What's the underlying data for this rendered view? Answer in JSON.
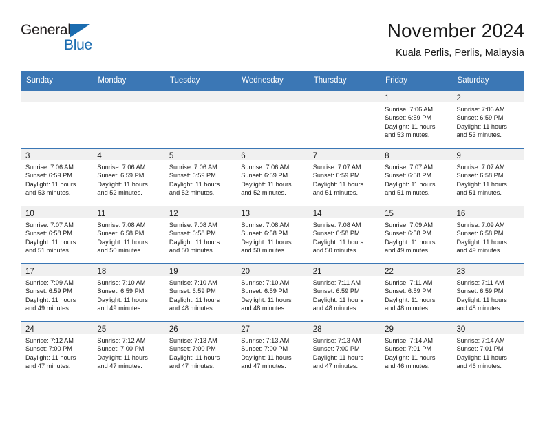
{
  "logo": {
    "word_top": "General",
    "word_bottom": "Blue",
    "triangle_color": "#1b6cb0",
    "top_color": "#231f20",
    "bottom_color": "#1b6cb0"
  },
  "header": {
    "title": "November 2024",
    "subtitle": "Kuala Perlis, Perlis, Malaysia"
  },
  "theme": {
    "header_blue": "#3b77b5",
    "daynum_band": "#f0f0f0",
    "text": "#1a1a1a"
  },
  "weekdays": [
    "Sunday",
    "Monday",
    "Tuesday",
    "Wednesday",
    "Thursday",
    "Friday",
    "Saturday"
  ],
  "weeks": [
    [
      {
        "day": "",
        "empty": true
      },
      {
        "day": "",
        "empty": true
      },
      {
        "day": "",
        "empty": true
      },
      {
        "day": "",
        "empty": true
      },
      {
        "day": "",
        "empty": true
      },
      {
        "day": "1",
        "sunrise": "Sunrise: 7:06 AM",
        "sunset": "Sunset: 6:59 PM",
        "daylight1": "Daylight: 11 hours",
        "daylight2": "and 53 minutes."
      },
      {
        "day": "2",
        "sunrise": "Sunrise: 7:06 AM",
        "sunset": "Sunset: 6:59 PM",
        "daylight1": "Daylight: 11 hours",
        "daylight2": "and 53 minutes."
      }
    ],
    [
      {
        "day": "3",
        "sunrise": "Sunrise: 7:06 AM",
        "sunset": "Sunset: 6:59 PM",
        "daylight1": "Daylight: 11 hours",
        "daylight2": "and 53 minutes."
      },
      {
        "day": "4",
        "sunrise": "Sunrise: 7:06 AM",
        "sunset": "Sunset: 6:59 PM",
        "daylight1": "Daylight: 11 hours",
        "daylight2": "and 52 minutes."
      },
      {
        "day": "5",
        "sunrise": "Sunrise: 7:06 AM",
        "sunset": "Sunset: 6:59 PM",
        "daylight1": "Daylight: 11 hours",
        "daylight2": "and 52 minutes."
      },
      {
        "day": "6",
        "sunrise": "Sunrise: 7:06 AM",
        "sunset": "Sunset: 6:59 PM",
        "daylight1": "Daylight: 11 hours",
        "daylight2": "and 52 minutes."
      },
      {
        "day": "7",
        "sunrise": "Sunrise: 7:07 AM",
        "sunset": "Sunset: 6:59 PM",
        "daylight1": "Daylight: 11 hours",
        "daylight2": "and 51 minutes."
      },
      {
        "day": "8",
        "sunrise": "Sunrise: 7:07 AM",
        "sunset": "Sunset: 6:58 PM",
        "daylight1": "Daylight: 11 hours",
        "daylight2": "and 51 minutes."
      },
      {
        "day": "9",
        "sunrise": "Sunrise: 7:07 AM",
        "sunset": "Sunset: 6:58 PM",
        "daylight1": "Daylight: 11 hours",
        "daylight2": "and 51 minutes."
      }
    ],
    [
      {
        "day": "10",
        "sunrise": "Sunrise: 7:07 AM",
        "sunset": "Sunset: 6:58 PM",
        "daylight1": "Daylight: 11 hours",
        "daylight2": "and 51 minutes."
      },
      {
        "day": "11",
        "sunrise": "Sunrise: 7:08 AM",
        "sunset": "Sunset: 6:58 PM",
        "daylight1": "Daylight: 11 hours",
        "daylight2": "and 50 minutes."
      },
      {
        "day": "12",
        "sunrise": "Sunrise: 7:08 AM",
        "sunset": "Sunset: 6:58 PM",
        "daylight1": "Daylight: 11 hours",
        "daylight2": "and 50 minutes."
      },
      {
        "day": "13",
        "sunrise": "Sunrise: 7:08 AM",
        "sunset": "Sunset: 6:58 PM",
        "daylight1": "Daylight: 11 hours",
        "daylight2": "and 50 minutes."
      },
      {
        "day": "14",
        "sunrise": "Sunrise: 7:08 AM",
        "sunset": "Sunset: 6:58 PM",
        "daylight1": "Daylight: 11 hours",
        "daylight2": "and 50 minutes."
      },
      {
        "day": "15",
        "sunrise": "Sunrise: 7:09 AM",
        "sunset": "Sunset: 6:58 PM",
        "daylight1": "Daylight: 11 hours",
        "daylight2": "and 49 minutes."
      },
      {
        "day": "16",
        "sunrise": "Sunrise: 7:09 AM",
        "sunset": "Sunset: 6:58 PM",
        "daylight1": "Daylight: 11 hours",
        "daylight2": "and 49 minutes."
      }
    ],
    [
      {
        "day": "17",
        "sunrise": "Sunrise: 7:09 AM",
        "sunset": "Sunset: 6:59 PM",
        "daylight1": "Daylight: 11 hours",
        "daylight2": "and 49 minutes."
      },
      {
        "day": "18",
        "sunrise": "Sunrise: 7:10 AM",
        "sunset": "Sunset: 6:59 PM",
        "daylight1": "Daylight: 11 hours",
        "daylight2": "and 49 minutes."
      },
      {
        "day": "19",
        "sunrise": "Sunrise: 7:10 AM",
        "sunset": "Sunset: 6:59 PM",
        "daylight1": "Daylight: 11 hours",
        "daylight2": "and 48 minutes."
      },
      {
        "day": "20",
        "sunrise": "Sunrise: 7:10 AM",
        "sunset": "Sunset: 6:59 PM",
        "daylight1": "Daylight: 11 hours",
        "daylight2": "and 48 minutes."
      },
      {
        "day": "21",
        "sunrise": "Sunrise: 7:11 AM",
        "sunset": "Sunset: 6:59 PM",
        "daylight1": "Daylight: 11 hours",
        "daylight2": "and 48 minutes."
      },
      {
        "day": "22",
        "sunrise": "Sunrise: 7:11 AM",
        "sunset": "Sunset: 6:59 PM",
        "daylight1": "Daylight: 11 hours",
        "daylight2": "and 48 minutes."
      },
      {
        "day": "23",
        "sunrise": "Sunrise: 7:11 AM",
        "sunset": "Sunset: 6:59 PM",
        "daylight1": "Daylight: 11 hours",
        "daylight2": "and 48 minutes."
      }
    ],
    [
      {
        "day": "24",
        "sunrise": "Sunrise: 7:12 AM",
        "sunset": "Sunset: 7:00 PM",
        "daylight1": "Daylight: 11 hours",
        "daylight2": "and 47 minutes."
      },
      {
        "day": "25",
        "sunrise": "Sunrise: 7:12 AM",
        "sunset": "Sunset: 7:00 PM",
        "daylight1": "Daylight: 11 hours",
        "daylight2": "and 47 minutes."
      },
      {
        "day": "26",
        "sunrise": "Sunrise: 7:13 AM",
        "sunset": "Sunset: 7:00 PM",
        "daylight1": "Daylight: 11 hours",
        "daylight2": "and 47 minutes."
      },
      {
        "day": "27",
        "sunrise": "Sunrise: 7:13 AM",
        "sunset": "Sunset: 7:00 PM",
        "daylight1": "Daylight: 11 hours",
        "daylight2": "and 47 minutes."
      },
      {
        "day": "28",
        "sunrise": "Sunrise: 7:13 AM",
        "sunset": "Sunset: 7:00 PM",
        "daylight1": "Daylight: 11 hours",
        "daylight2": "and 47 minutes."
      },
      {
        "day": "29",
        "sunrise": "Sunrise: 7:14 AM",
        "sunset": "Sunset: 7:01 PM",
        "daylight1": "Daylight: 11 hours",
        "daylight2": "and 46 minutes."
      },
      {
        "day": "30",
        "sunrise": "Sunrise: 7:14 AM",
        "sunset": "Sunset: 7:01 PM",
        "daylight1": "Daylight: 11 hours",
        "daylight2": "and 46 minutes."
      }
    ]
  ]
}
